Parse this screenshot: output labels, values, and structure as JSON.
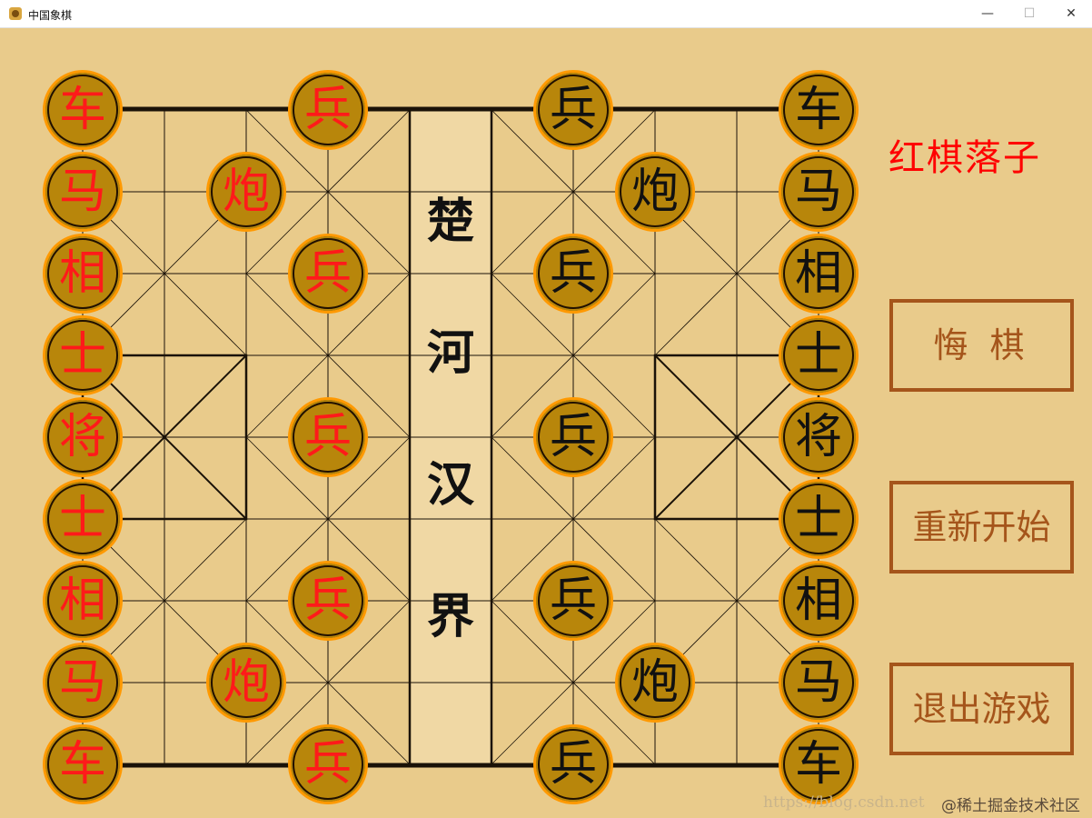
{
  "window": {
    "title": "中国象棋",
    "min": "—",
    "max": "☐",
    "close": "✕"
  },
  "river": [
    "楚",
    "河",
    "汉",
    "界"
  ],
  "status": "红棋落子",
  "buttons": {
    "undo": "悔棋",
    "restart": "重新开始",
    "quit": "退出游戏"
  },
  "watermark": {
    "url": "https://blog.csdn.net",
    "community": "@稀土掘金技术社区"
  },
  "colors": {
    "board": "#e9cb8b",
    "piece": "#b8860b",
    "piece_ring": "#ff9900",
    "red": "#ff1a1a",
    "black": "#111111",
    "button": "#a5551b"
  },
  "pieces": [
    {
      "c": "车",
      "side": "red",
      "col": 0,
      "row": 0
    },
    {
      "c": "马",
      "side": "red",
      "col": 0,
      "row": 1
    },
    {
      "c": "相",
      "side": "red",
      "col": 0,
      "row": 2
    },
    {
      "c": "士",
      "side": "red",
      "col": 0,
      "row": 3
    },
    {
      "c": "将",
      "side": "red",
      "col": 0,
      "row": 4
    },
    {
      "c": "士",
      "side": "red",
      "col": 0,
      "row": 5
    },
    {
      "c": "相",
      "side": "red",
      "col": 0,
      "row": 6
    },
    {
      "c": "马",
      "side": "red",
      "col": 0,
      "row": 7
    },
    {
      "c": "车",
      "side": "red",
      "col": 0,
      "row": 8
    },
    {
      "c": "炮",
      "side": "red",
      "col": 2,
      "row": 1
    },
    {
      "c": "炮",
      "side": "red",
      "col": 2,
      "row": 7
    },
    {
      "c": "兵",
      "side": "red",
      "col": 3,
      "row": 0
    },
    {
      "c": "兵",
      "side": "red",
      "col": 3,
      "row": 2
    },
    {
      "c": "兵",
      "side": "red",
      "col": 3,
      "row": 4
    },
    {
      "c": "兵",
      "side": "red",
      "col": 3,
      "row": 6
    },
    {
      "c": "兵",
      "side": "red",
      "col": 3,
      "row": 8
    },
    {
      "c": "兵",
      "side": "black",
      "col": 6,
      "row": 0
    },
    {
      "c": "兵",
      "side": "black",
      "col": 6,
      "row": 2
    },
    {
      "c": "兵",
      "side": "black",
      "col": 6,
      "row": 4
    },
    {
      "c": "兵",
      "side": "black",
      "col": 6,
      "row": 6
    },
    {
      "c": "兵",
      "side": "black",
      "col": 6,
      "row": 8
    },
    {
      "c": "炮",
      "side": "black",
      "col": 7,
      "row": 1
    },
    {
      "c": "炮",
      "side": "black",
      "col": 7,
      "row": 7
    },
    {
      "c": "车",
      "side": "black",
      "col": 9,
      "row": 0
    },
    {
      "c": "马",
      "side": "black",
      "col": 9,
      "row": 1
    },
    {
      "c": "相",
      "side": "black",
      "col": 9,
      "row": 2
    },
    {
      "c": "士",
      "side": "black",
      "col": 9,
      "row": 3
    },
    {
      "c": "将",
      "side": "black",
      "col": 9,
      "row": 4
    },
    {
      "c": "士",
      "side": "black",
      "col": 9,
      "row": 5
    },
    {
      "c": "相",
      "side": "black",
      "col": 9,
      "row": 6
    },
    {
      "c": "马",
      "side": "black",
      "col": 9,
      "row": 7
    },
    {
      "c": "车",
      "side": "black",
      "col": 9,
      "row": 8
    }
  ]
}
